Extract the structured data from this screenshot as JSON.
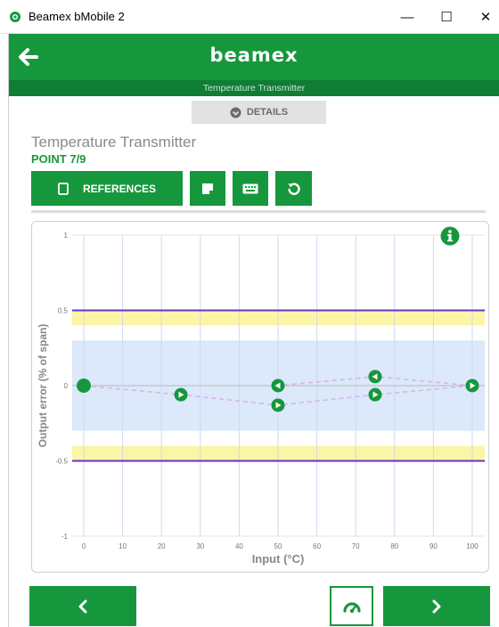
{
  "window": {
    "title": "Beamex bMobile 2",
    "minimize": "—",
    "maximize": "☐",
    "close": "✕"
  },
  "header": {
    "logo_text": "beamex",
    "subtitle": "Temperature Transmitter"
  },
  "details_tab": {
    "label": "DETAILS",
    "icon": "chevron-down-circle-icon"
  },
  "page": {
    "title": "Temperature Transmitter",
    "point": "POINT 7/9"
  },
  "toolbar": {
    "references_label": "REFERENCES",
    "references_icon": "tablet-icon",
    "note_icon": "note-icon",
    "keyboard_icon": "keyboard-icon",
    "reset_icon": "reset-icon"
  },
  "colors": {
    "brand_green": "#17973d",
    "brand_green_dark": "#0f7d33",
    "limit_line": "#6633cc",
    "warning_band": "#fbf6a6",
    "tolerance_band": "#dbe9fb",
    "dashed_trace": "#d8b5e6"
  },
  "chart_data": {
    "type": "scatter",
    "xlabel": "Input (°C)",
    "ylabel": "Output error (% of span)",
    "xlim": [
      0,
      100
    ],
    "ylim": [
      -1,
      1
    ],
    "xticks": [
      0,
      10,
      20,
      30,
      40,
      50,
      60,
      70,
      80,
      90,
      100
    ],
    "yticks": [
      1,
      0.5,
      0,
      -0.5,
      -1
    ],
    "ytick_labels": [
      "1",
      "0.5",
      "0",
      "-0.5",
      "-1"
    ],
    "grid": true,
    "limit_lines": [
      0.5,
      -0.5
    ],
    "warning_bands": [
      [
        0.4,
        0.5
      ],
      [
        -0.5,
        -0.4
      ]
    ],
    "tolerance_band": [
      -0.3,
      0.3
    ],
    "upward_points": [
      {
        "x": 0,
        "y": 0
      },
      {
        "x": 25,
        "y": -0.06
      },
      {
        "x": 50,
        "y": -0.13
      },
      {
        "x": 75,
        "y": -0.06
      },
      {
        "x": 100,
        "y": 0
      }
    ],
    "downward_points": [
      {
        "x": 100,
        "y": 0
      },
      {
        "x": 75,
        "y": 0.06
      },
      {
        "x": 50,
        "y": 0
      }
    ],
    "current_point": {
      "x": 0,
      "y": 0
    }
  },
  "footer": {
    "prev_icon": "chevron-left-icon",
    "gauge_icon": "gauge-icon",
    "next_icon": "chevron-right-icon"
  }
}
